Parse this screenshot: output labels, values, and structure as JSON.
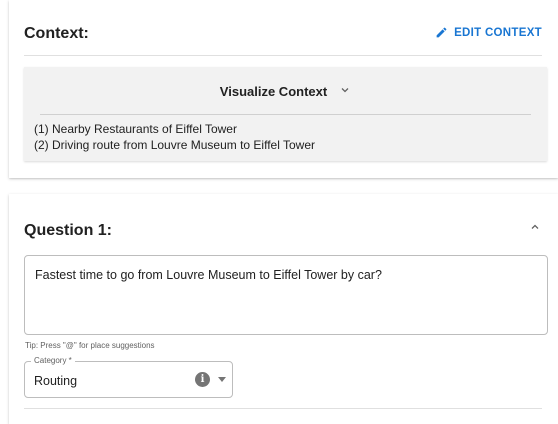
{
  "context": {
    "title": "Context:",
    "edit_label": "EDIT CONTEXT",
    "visualize_label": "Visualize Context",
    "items": [
      "(1) Nearby Restaurants of Eiffel Tower",
      "(2) Driving route from Louvre Museum to Eiffel Tower"
    ]
  },
  "question": {
    "title": "Question 1:",
    "text": "Fastest time to go from Louvre Museum to Eiffel Tower by car?",
    "tip": "Tip: Press \"@\" for place suggestions",
    "category_label": "Category *",
    "category_value": "Routing",
    "info_icon": "i"
  },
  "colors": {
    "accent": "#1976d2",
    "panel_bg": "#f2f2f2"
  },
  "icons": {
    "edit": "pencil-icon",
    "expand": "chevron-down-icon",
    "collapse": "chevron-up-icon",
    "info": "info-icon",
    "dropdown": "caret-down-icon"
  }
}
